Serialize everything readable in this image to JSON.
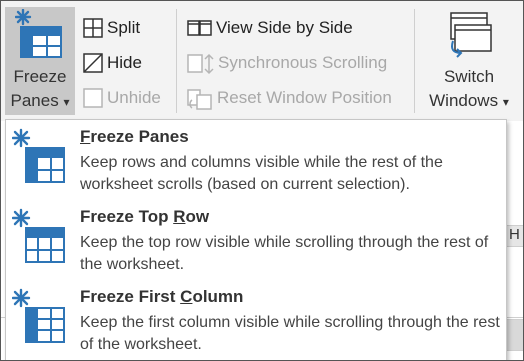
{
  "ribbon": {
    "freeze_panes": {
      "line1": "Freeze",
      "line2": "Panes",
      "dropdown_arrow": "▾"
    },
    "split_label": "Split",
    "hide_label": "Hide",
    "unhide_label": "Unhide",
    "view_side_by_side_label": "View Side by Side",
    "synchronous_scrolling_label": "Synchronous Scrolling",
    "reset_window_position_label": "Reset Window Position",
    "switch_windows": {
      "line1": "Switch",
      "line2": "Windows",
      "dropdown_arrow": "▾"
    }
  },
  "sheet": {
    "right_header_letter": "H",
    "bottom_right_text": "ts"
  },
  "menu": {
    "items": [
      {
        "title_pre": "",
        "title_key": "F",
        "title_post": "reeze Panes",
        "description": "Keep rows and columns visible while the rest of the worksheet scrolls (based on current selection)."
      },
      {
        "title_pre": "Freeze Top ",
        "title_key": "R",
        "title_post": "ow",
        "description": "Keep the top row visible while scrolling through the rest of the worksheet."
      },
      {
        "title_pre": "Freeze First ",
        "title_key": "C",
        "title_post": "olumn",
        "description": "Keep the first column visible while scrolling through the rest of the worksheet."
      }
    ]
  },
  "colors": {
    "accent_blue": "#2e75b6",
    "ribbon_bg": "#f3f3f3",
    "selected_button": "#c8c8c8",
    "disabled_text": "#a8a8a8"
  }
}
